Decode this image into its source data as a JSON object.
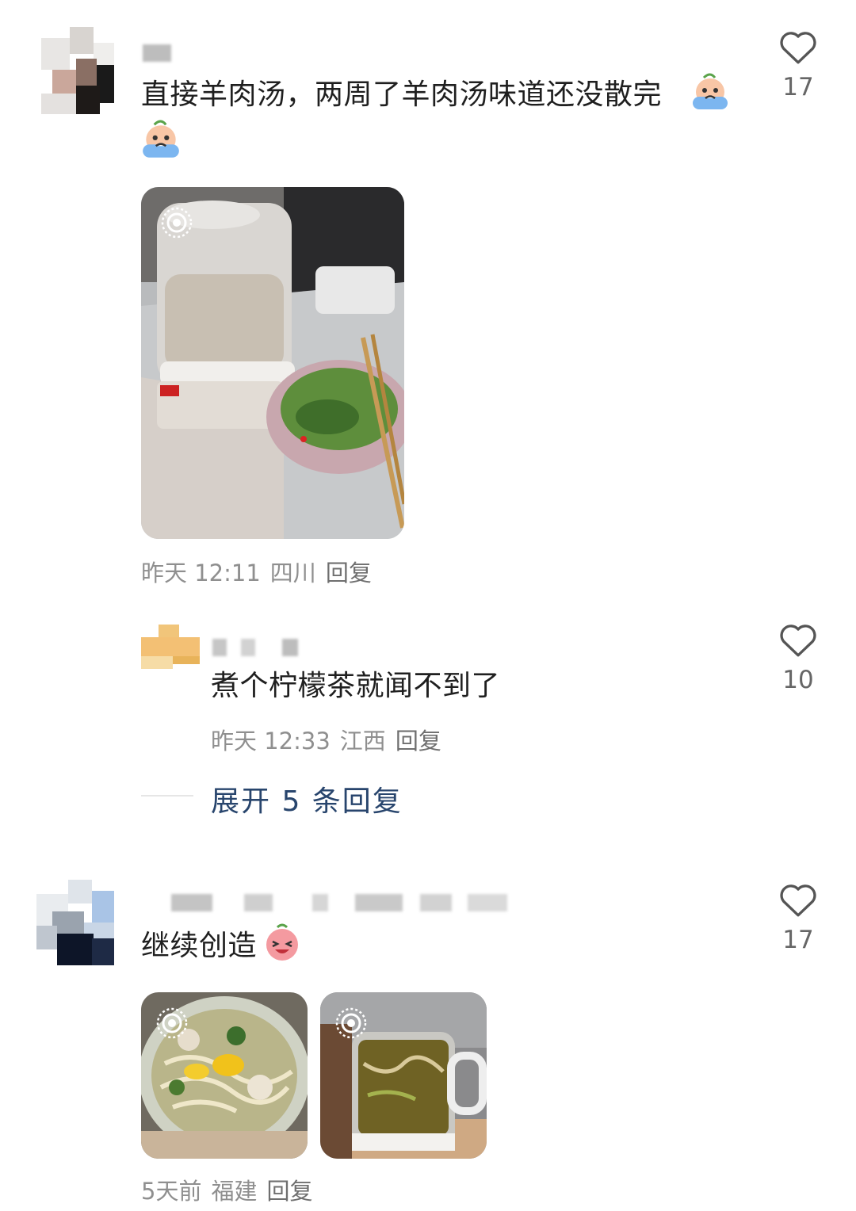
{
  "comments": [
    {
      "text": "直接羊肉汤，两周了羊肉汤味道还没散完",
      "time": "昨天 12:11",
      "location": "四川",
      "reply_label": "回复",
      "likes": "17",
      "emojis": [
        "crying-face-emoji",
        "crying-face-emoji"
      ],
      "images": [
        "kettle-with-soup-and-herb-bowl-photo"
      ],
      "replies": [
        {
          "text": "煮个柠檬茶就闻不到了",
          "time": "昨天 12:33",
          "location": "江西",
          "reply_label": "回复",
          "likes": "10"
        }
      ],
      "expand_label": "展开 5 条回复"
    },
    {
      "text": "继续创造",
      "time": "5天前",
      "location": "福建",
      "reply_label": "回复",
      "likes": "17",
      "emojis": [
        "laughing-face-emoji"
      ],
      "images": [
        "noodle-soup-pot-photo",
        "soup-mug-photo"
      ]
    }
  ],
  "colors": {
    "text": "#1f1f1f",
    "meta": "#8f8f8f",
    "link": "#28456d",
    "icon": "#555555"
  },
  "icons": [
    "heart-icon",
    "live-photo-icon"
  ]
}
